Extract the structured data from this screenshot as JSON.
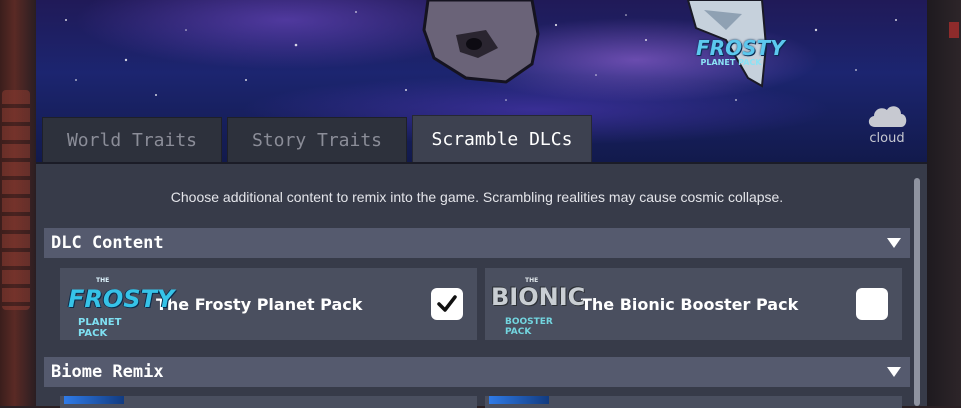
{
  "tabs": [
    {
      "label": "World Traits"
    },
    {
      "label": "Story Traits"
    },
    {
      "label": "Scramble DLCs"
    }
  ],
  "cloud_label": "cloud",
  "banner_logo": {
    "line1": "FROSTY",
    "line2": "PLANET PACK"
  },
  "description": "Choose additional content to remix into the game. Scrambling realities may cause cosmic collapse.",
  "sections": [
    {
      "title": "DLC Content"
    },
    {
      "title": "Biome Remix"
    }
  ],
  "dlc_cards": [
    {
      "name": "The Frosty Planet Pack",
      "checked": true,
      "logo": {
        "the": "THE",
        "title": "FROSTY",
        "sub": "PLANET PACK"
      }
    },
    {
      "name": "The Bionic Booster Pack",
      "checked": false,
      "logo": {
        "the": "THE",
        "title": "BIONIC",
        "sub": "BOOSTER PACK"
      }
    }
  ],
  "colors": {
    "accent_frosty": "#36c3e8",
    "accent_bionic": "#73d6e0",
    "header_bg": "#555a6e",
    "card_bg": "#4a4f5f"
  }
}
